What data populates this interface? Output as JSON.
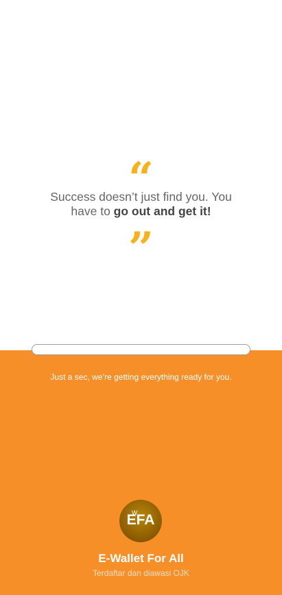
{
  "quote": {
    "open_mark": "“",
    "close_mark": "”",
    "text_part1": "Success doesn’t just find you. You have to ",
    "text_bold": "go out and get it!"
  },
  "loading": {
    "progress": 0.0,
    "status": "Just a sec, we’re getting everything ready for you."
  },
  "brand": {
    "logo_main": "EFA",
    "logo_sub": "W",
    "app_name": "E-Wallet For All",
    "registration": "Terdaftar dan diawasi OJK"
  },
  "colors": {
    "accent_orange": "#F78F28",
    "quote_yellow": "#F5B21B",
    "logo_gold": "#B8860B"
  }
}
